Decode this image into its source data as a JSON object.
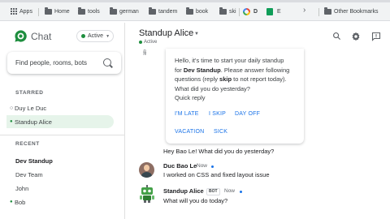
{
  "bookmarks": {
    "items": [
      "Apps",
      "Home",
      "tools",
      "german",
      "tandem",
      "book",
      "ski"
    ],
    "extra": [
      "D",
      "E"
    ],
    "other": "Other Bookmarks"
  },
  "app": {
    "title": "Chat"
  },
  "status": {
    "label": "Active"
  },
  "search": {
    "placeholder": "Find people, rooms, bots"
  },
  "sidebar": {
    "starred_label": "STARRED",
    "starred": [
      {
        "name": "Duy Le Duc",
        "prefix": "○"
      },
      {
        "name": "Standup Alice",
        "prefix": "●"
      }
    ],
    "recent_label": "RECENT",
    "recent": [
      {
        "name": "Dev Standup",
        "bold": true
      },
      {
        "name": "Dev Team",
        "bold": false
      },
      {
        "name": "John",
        "bold": false
      },
      {
        "name": "Bob",
        "prefix": "●",
        "bold": false
      }
    ]
  },
  "chat": {
    "title": "Standup Alice",
    "status": "Active"
  },
  "card": {
    "line1": "Hello, it's time to start your daily standup",
    "line2_pre": "for ",
    "line2_bold": "Dev Standup",
    "line2_post": ". Please answer following",
    "line3_pre": "questions (reply ",
    "line3_bold": "skip",
    "line3_post": " to not report today).",
    "line4": "What did you do yesterday?",
    "line5": "Quick reply",
    "actions": [
      "I'M LATE",
      "I SKIP",
      "DAY OFF",
      "VACATION",
      "SICK"
    ]
  },
  "messages": {
    "bot_question": "Hey Bao Le! What did you do yesterday?",
    "user_name": "Duc Bao Le",
    "user_time": "Now",
    "user_text": "I worked on CSS and fixed layout issue",
    "bot_name": "Standup Alice",
    "bot_badge": "BOT",
    "bot_time": "Now",
    "bot_text": "What will you do today?"
  },
  "colors": {
    "accent": "#1a73e8",
    "active_green": "#1e8e3e",
    "active_bg": "#e6f4ea"
  },
  "icons": [
    "search-icon",
    "gear-icon",
    "feedback-icon",
    "chevron-down-icon",
    "folder-icon",
    "apps-grid-icon"
  ]
}
